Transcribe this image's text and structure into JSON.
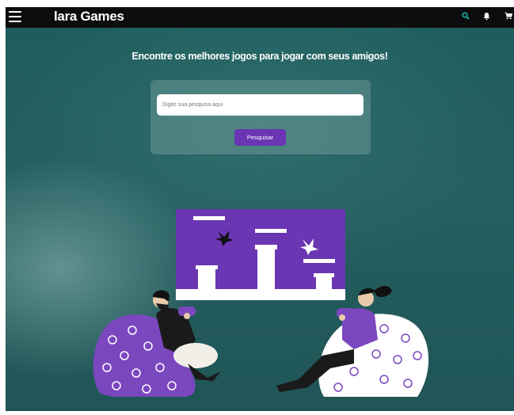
{
  "app": {
    "title": "lara Games"
  },
  "header": {
    "menu_icon": "hamburger-menu-icon",
    "icons": [
      {
        "name": "search-icon",
        "color": "#17b6a6"
      },
      {
        "name": "bell-icon",
        "color": "#ffffff"
      },
      {
        "name": "cart-icon",
        "color": "#ffffff"
      }
    ]
  },
  "hero": {
    "headline": "Encontre os melhores jogos para jogar com seus amigos!"
  },
  "search": {
    "placeholder": "Digite sua pesquisa aqui",
    "value": "",
    "button_label": "Pesquisar"
  },
  "colors": {
    "accent": "#6a36b3",
    "topbar": "#0b0d0e",
    "background": "#1f5a5b",
    "icon_highlight": "#17b6a6"
  },
  "illustration": {
    "subject": "two-people-playing-video-games-on-bean-bags",
    "elements": [
      "game-screen",
      "bird-icon",
      "left-player",
      "right-player",
      "purple-bean-bag",
      "white-bean-bag",
      "gamepad"
    ]
  }
}
